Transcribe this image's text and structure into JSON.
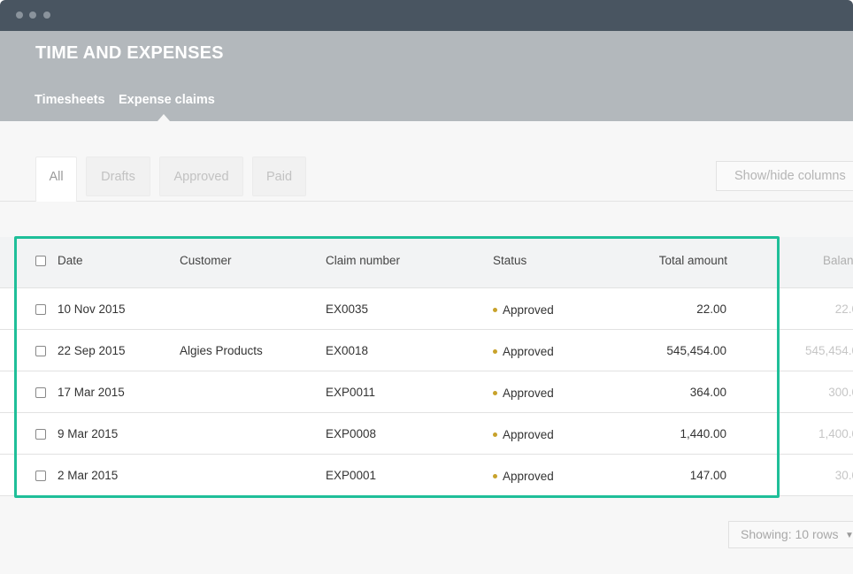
{
  "window": {
    "controls": [
      "close",
      "minimize",
      "maximize"
    ]
  },
  "header": {
    "title": "TIME AND EXPENSES",
    "nav": [
      {
        "label": "Timesheets",
        "active": false
      },
      {
        "label": "Expense claims",
        "active": true
      }
    ]
  },
  "filters": {
    "tabs": [
      {
        "label": "All",
        "active": true
      },
      {
        "label": "Drafts",
        "active": false
      },
      {
        "label": "Approved",
        "active": false
      },
      {
        "label": "Paid",
        "active": false
      }
    ],
    "show_hide_label": "Show/hide columns"
  },
  "table": {
    "columns": {
      "date": "Date",
      "customer": "Customer",
      "claim_number": "Claim number",
      "status": "Status",
      "total_amount": "Total amount",
      "balance": "Balan"
    },
    "rows": [
      {
        "date": "10 Nov 2015",
        "customer": "",
        "claim_number": "EX0035",
        "status": "Approved",
        "total_amount": "22.00",
        "balance": "22.0"
      },
      {
        "date": "22 Sep 2015",
        "customer": "Algies Products",
        "claim_number": "EX0018",
        "status": "Approved",
        "total_amount": "545,454.00",
        "balance": "545,454.0"
      },
      {
        "date": "17 Mar 2015",
        "customer": "",
        "claim_number": "EXP0011",
        "status": "Approved",
        "total_amount": "364.00",
        "balance": "300.0"
      },
      {
        "date": "9 Mar 2015",
        "customer": "",
        "claim_number": "EXP0008",
        "status": "Approved",
        "total_amount": "1,440.00",
        "balance": "1,400.0"
      },
      {
        "date": "2 Mar 2015",
        "customer": "",
        "claim_number": "EXP0001",
        "status": "Approved",
        "total_amount": "147.00",
        "balance": "30.0"
      }
    ]
  },
  "pagination": {
    "showing_label": "Showing: 10 rows"
  },
  "colors": {
    "titlebar": "#495561",
    "header": "#b3b8bc",
    "highlight": "#1fbf99",
    "status_approved": "#c8a22b"
  }
}
